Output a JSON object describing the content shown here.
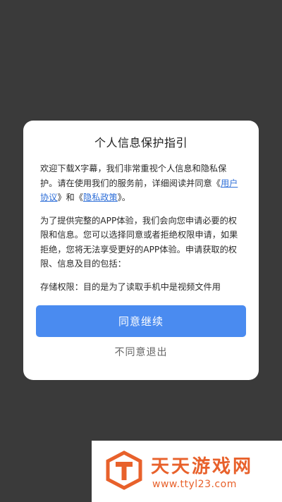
{
  "dialog": {
    "title": "个人信息保护指引",
    "p1_before": "欢迎下载X字幕，我们非常重视个人信息和隐私保护。请在使用我们的服务前，详细阅读并同意《",
    "link_user_agreement": "用户协议",
    "p1_middle": "》和《",
    "link_privacy_policy": "隐私政策",
    "p1_after": "》。",
    "p2": "为了提供完整的APP体验，我们会向您申请必要的权限和信息。您可以选择同意或者拒绝权限申请，如果拒绝，您将无法享受更好的APP体验。申请获取的权限、信息及目的包括：",
    "p3": "存储权限：目的是为了读取手机中是视频文件用",
    "agree_button": "同意继续",
    "exit_button": "不同意退出"
  },
  "watermark": {
    "title": "天天游戏网",
    "url": "www.ttyl23.com",
    "color": "#e8612b"
  },
  "colors": {
    "background": "#3a3a3a",
    "primary_button": "#4a8bf0",
    "link": "#2f6fd8"
  }
}
